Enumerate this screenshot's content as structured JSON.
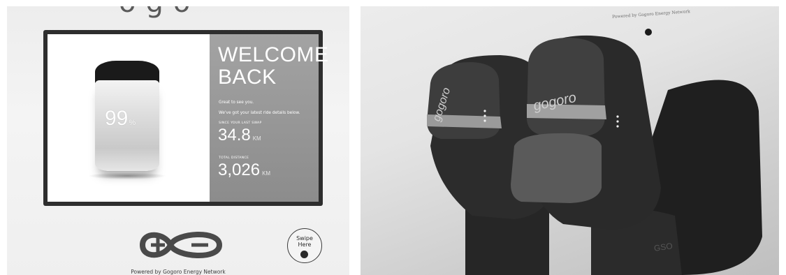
{
  "kiosk": {
    "brand_fragment": "ogo",
    "screen": {
      "battery_level": "99",
      "battery_unit": "%",
      "welcome_title": "WELCOME BACK",
      "greeting": "Great to see you.",
      "subtext": "We've got your latest ride details below.",
      "since_last_swap_label": "SINCE YOUR LAST SWAP",
      "since_last_swap_value": "34.8",
      "since_last_swap_unit": "KM",
      "total_distance_label": "TOTAL DISTANCE",
      "total_distance_value": "3,026",
      "total_distance_unit": "KM"
    },
    "swipe_label_line1": "Swipe",
    "swipe_label_line2": "Here",
    "powered_by": "Powered by Gogoro Energy Network",
    "icons": [
      "gogoro-energy-network-logo",
      "swipe-dot-icon"
    ]
  },
  "photo": {
    "network_text": "Powered by Gogoro Energy Network",
    "battery_brand_left": "gogoro",
    "battery_brand_right": "gogoro",
    "slot_text": "GSO",
    "colors": {
      "battery_dark": "#2b2b2b",
      "slot_dark": "#1e1e1e",
      "wall": "#e6e6e6"
    }
  }
}
